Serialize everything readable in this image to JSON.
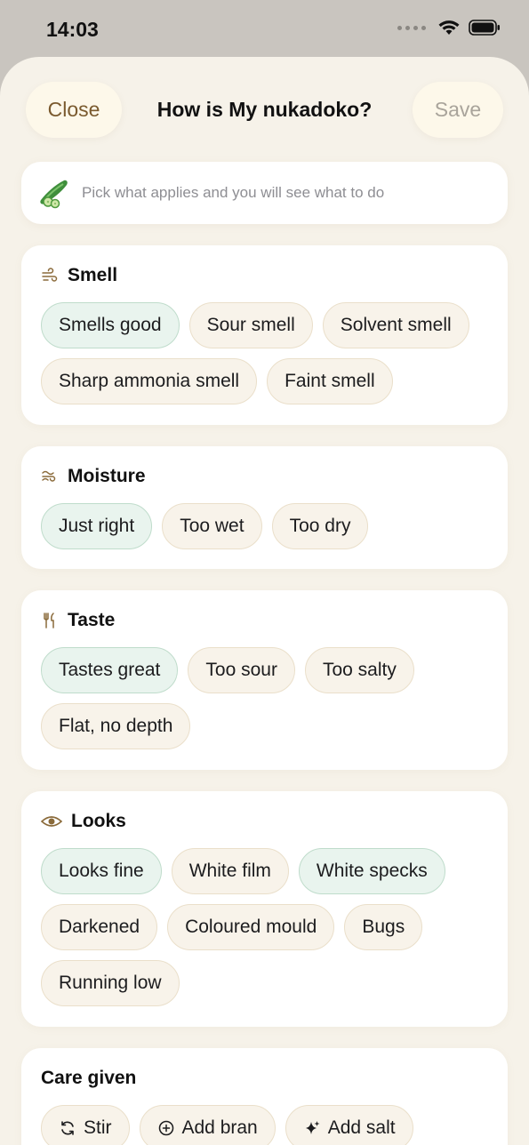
{
  "status_bar": {
    "time": "14:03"
  },
  "header": {
    "close_label": "Close",
    "title": "How is My nukadoko?",
    "save_label": "Save"
  },
  "hint": {
    "text": "Pick what applies and you will see what to do"
  },
  "sections": {
    "smell": {
      "title": "Smell",
      "chips": [
        "Smells good",
        "Sour smell",
        "Solvent smell",
        "Sharp ammonia smell",
        "Faint smell"
      ]
    },
    "moisture": {
      "title": "Moisture",
      "chips": [
        "Just right",
        "Too wet",
        "Too dry"
      ]
    },
    "taste": {
      "title": "Taste",
      "chips": [
        "Tastes great",
        "Too sour",
        "Too salty",
        "Flat, no depth"
      ]
    },
    "looks": {
      "title": "Looks",
      "chips": [
        "Looks fine",
        "White film",
        "White specks",
        "Darkened",
        "Coloured mould",
        "Bugs",
        "Running low"
      ]
    },
    "care": {
      "title": "Care given",
      "chips": [
        "Stir",
        "Add bran",
        "Add salt"
      ]
    }
  },
  "colors": {
    "accent_brown": "#7a5a2e",
    "good_chip_bg": "#e9f4ee",
    "neutral_chip_bg": "#f8f3ea",
    "sheet_bg": "#f6f2e9"
  },
  "icons": {
    "smell": "wind-icon",
    "moisture": "wind-wave-icon",
    "taste": "fork-knife-icon",
    "looks": "eye-icon",
    "stir": "refresh-icon",
    "add_bran": "plus-circle-icon",
    "add_salt": "sparkle-icon",
    "hint": "cucumber-icon"
  }
}
